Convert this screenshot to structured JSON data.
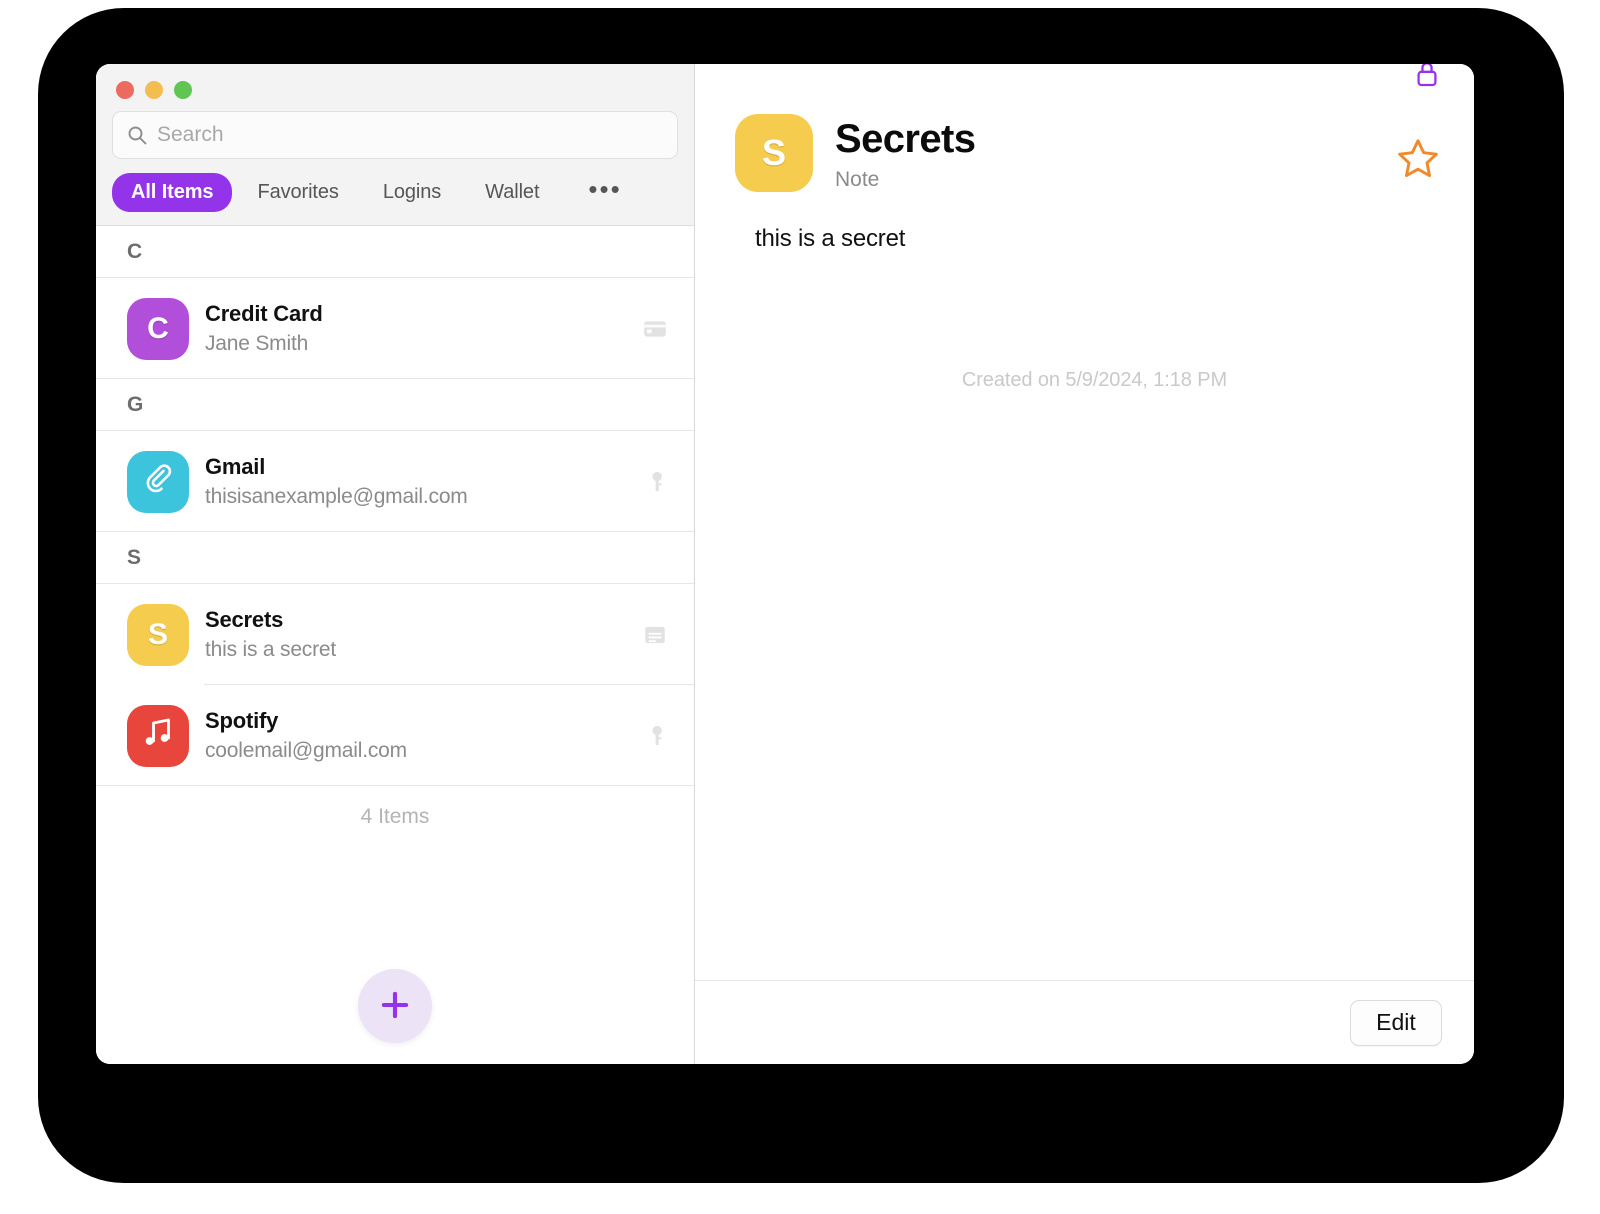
{
  "window": {
    "traffic_lights": [
      "close",
      "minimize",
      "zoom"
    ]
  },
  "search": {
    "placeholder": "Search",
    "value": "",
    "icon": "search-icon"
  },
  "tabs": {
    "items": [
      {
        "label": "All Items",
        "active": true
      },
      {
        "label": "Favorites",
        "active": false
      },
      {
        "label": "Logins",
        "active": false
      },
      {
        "label": "Wallet",
        "active": false
      }
    ],
    "more_label": "•••",
    "active_color": "#9333ea"
  },
  "list": {
    "sections": [
      {
        "letter": "C",
        "rows": [
          {
            "title": "Credit Card",
            "subtitle": "Jane Smith",
            "initial": "C",
            "avatar_color": "#b24fda",
            "avatar_kind": "letter",
            "type_icon": "credit-card-icon"
          }
        ]
      },
      {
        "letter": "G",
        "rows": [
          {
            "title": "Gmail",
            "subtitle": "thisisanexample@gmail.com",
            "initial": "",
            "avatar_color": "#3cc4dd",
            "avatar_kind": "paperclip",
            "type_icon": "key-icon"
          }
        ]
      },
      {
        "letter": "S",
        "rows": [
          {
            "title": "Secrets",
            "subtitle": "this is a secret",
            "initial": "S",
            "avatar_color": "#f6cc4f",
            "avatar_kind": "letter",
            "type_icon": "note-icon"
          },
          {
            "title": "Spotify",
            "subtitle": "coolemail@gmail.com",
            "initial": "",
            "avatar_color": "#e8453c",
            "avatar_kind": "music",
            "type_icon": "key-icon"
          }
        ]
      }
    ],
    "footer_count": "4 Items"
  },
  "add_button": {
    "icon": "plus-icon",
    "color": "#9333ea"
  },
  "detail": {
    "lock_icon": "lock-icon",
    "star_icon": "star-outline-icon",
    "avatar_initial": "S",
    "avatar_color": "#f6cc4f",
    "title": "Secrets",
    "subtitle": "Note",
    "note_text": "this is a secret",
    "created_on": "Created on 5/9/2024, 1:18 PM",
    "edit_label": "Edit"
  }
}
